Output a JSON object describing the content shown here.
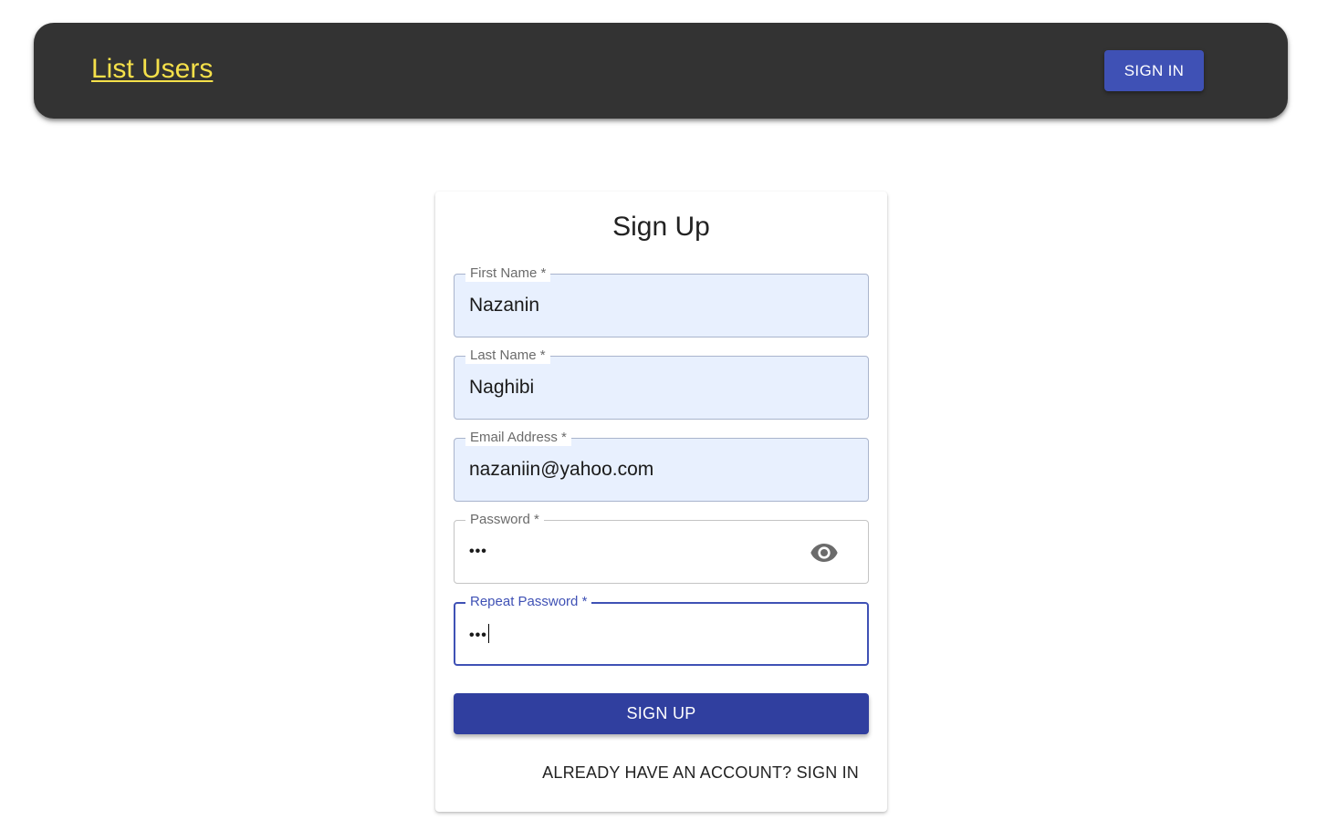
{
  "header": {
    "brand_link": "List Users",
    "signin_button": "SIGN IN"
  },
  "form": {
    "title": "Sign Up",
    "fields": [
      {
        "label": "First Name *",
        "value": "Nazanin",
        "state": "autofilled"
      },
      {
        "label": "Last Name *",
        "value": "Naghibi",
        "state": "autofilled"
      },
      {
        "label": "Email Address *",
        "value": "nazaniin@yahoo.com",
        "state": "autofilled"
      },
      {
        "label": "Password *",
        "value": "•••",
        "state": "masked",
        "icon": "eye-icon"
      },
      {
        "label": "Repeat Password *",
        "value": "•••",
        "state": "focused"
      }
    ],
    "submit_label": "SIGN UP",
    "signin_link": "ALREADY HAVE AN ACCOUNT? SIGN IN"
  },
  "colors": {
    "appbar_bg": "#333333",
    "brand_link": "#f5e04a",
    "primary": "#3f51b5",
    "primary_dark": "#303f9f",
    "autofill_bg": "#e8f0fe"
  }
}
